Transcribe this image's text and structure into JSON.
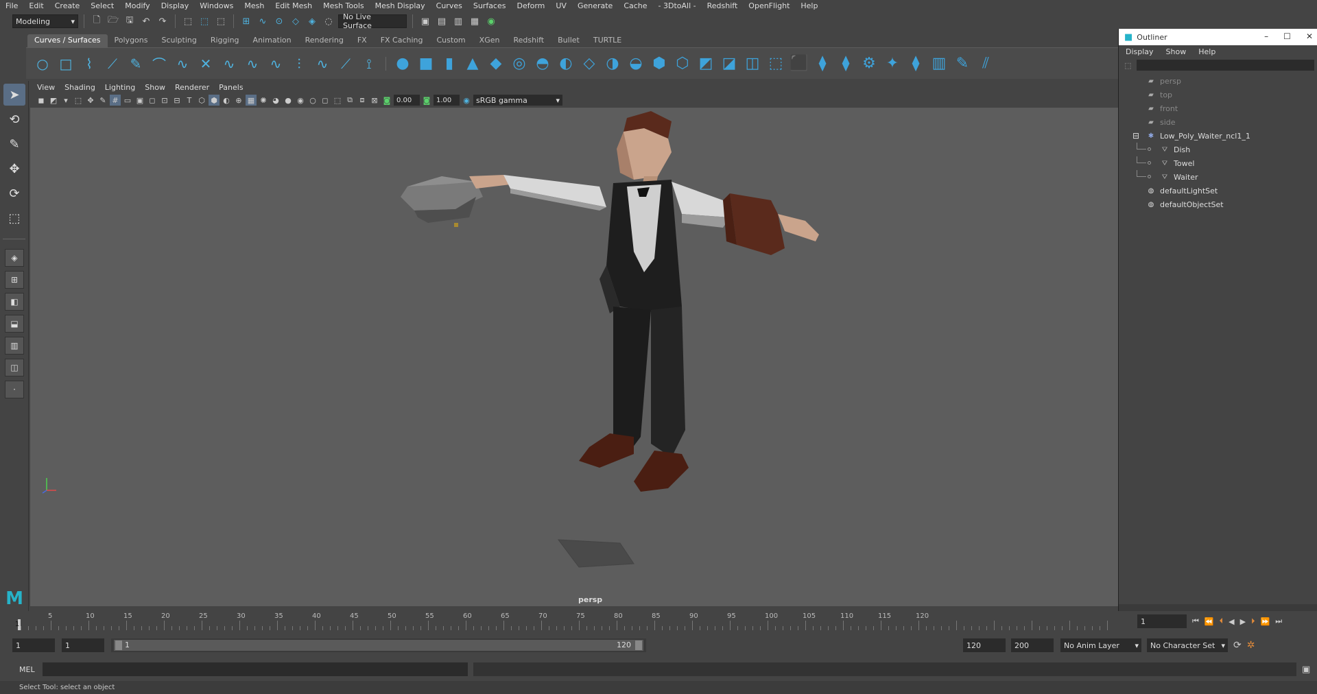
{
  "menubar": [
    "File",
    "Edit",
    "Create",
    "Select",
    "Modify",
    "Display",
    "Windows",
    "Mesh",
    "Edit Mesh",
    "Mesh Tools",
    "Mesh Display",
    "Curves",
    "Surfaces",
    "Deform",
    "UV",
    "Generate",
    "Cache",
    "- 3DtoAll -",
    "Redshift",
    "OpenFlight",
    "Help"
  ],
  "statusline": {
    "mode": "Modeling",
    "live_surface": "No Live Surface"
  },
  "shelf_tabs": [
    "Curves / Surfaces",
    "Polygons",
    "Sculpting",
    "Rigging",
    "Animation",
    "Rendering",
    "FX",
    "FX Caching",
    "Custom",
    "XGen",
    "Redshift",
    "Bullet",
    "TURTLE"
  ],
  "shelf_active": "Curves / Surfaces",
  "viewport_menu": [
    "View",
    "Shading",
    "Lighting",
    "Show",
    "Renderer",
    "Panels"
  ],
  "viewport_toolbar": {
    "exposure": "0.00",
    "gamma": "1.00",
    "color_space": "sRGB gamma"
  },
  "viewport": {
    "camera_label": "persp",
    "background": "#5d5d5d"
  },
  "outliner": {
    "title": "Outliner",
    "menu": [
      "Display",
      "Show",
      "Help"
    ],
    "items": [
      {
        "label": "persp",
        "icon": "camera-icon",
        "level": 0,
        "dim": true
      },
      {
        "label": "top",
        "icon": "camera-icon",
        "level": 0,
        "dim": true
      },
      {
        "label": "front",
        "icon": "camera-icon",
        "level": 0,
        "dim": true
      },
      {
        "label": "side",
        "icon": "camera-icon",
        "level": 0,
        "dim": true
      },
      {
        "label": "Low_Poly_Waiter_ncl1_1",
        "icon": "group-icon",
        "level": 0,
        "dim": false,
        "expanded": true
      },
      {
        "label": "Dish",
        "icon": "mesh-icon",
        "level": 1,
        "dim": false
      },
      {
        "label": "Towel",
        "icon": "mesh-icon",
        "level": 1,
        "dim": false
      },
      {
        "label": "Waiter",
        "icon": "mesh-icon",
        "level": 1,
        "dim": false
      },
      {
        "label": "defaultLightSet",
        "icon": "set-icon",
        "level": 0,
        "dim": false
      },
      {
        "label": "defaultObjectSet",
        "icon": "set-icon",
        "level": 0,
        "dim": false
      }
    ]
  },
  "timeline": {
    "ticks": [
      "5",
      "10",
      "15",
      "20",
      "25",
      "30",
      "35",
      "40",
      "45",
      "50",
      "55",
      "60",
      "65",
      "70",
      "75",
      "80",
      "85",
      "90",
      "95",
      "100",
      "105",
      "110",
      "115",
      "120"
    ],
    "start_marker": "1",
    "current_frame": "1"
  },
  "range": {
    "start_time": "1",
    "playback_start": "1",
    "slider_start": "1",
    "slider_end": "120",
    "playback_end": "120",
    "end_time": "200",
    "anim_layer": "No Anim Layer",
    "character_set": "No Character Set"
  },
  "command_line": {
    "language": "MEL"
  },
  "helpline": "Select Tool: select an object"
}
